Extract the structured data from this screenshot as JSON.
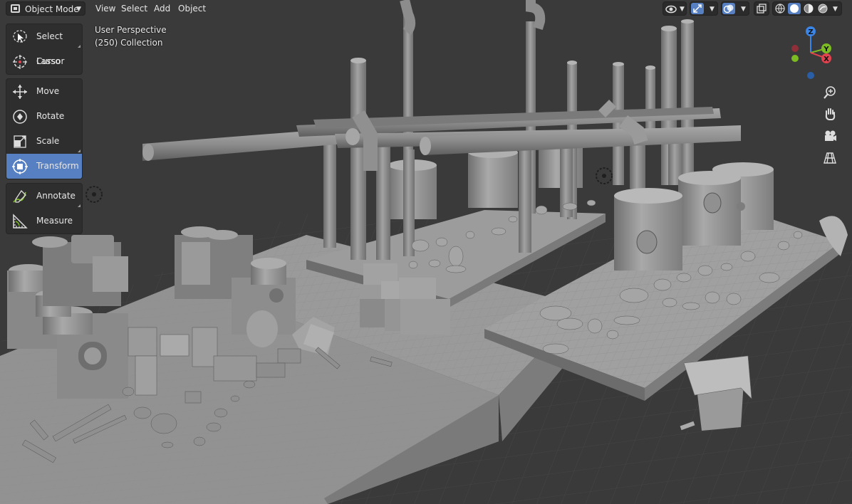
{
  "header": {
    "mode": "Object Mode",
    "menus": [
      "View",
      "Select",
      "Add",
      "Object"
    ],
    "icons": {
      "visibility": "eye-icon",
      "gizmo": "gizmo-icon",
      "overlays": "overlays-icon",
      "xray": "xray-icon",
      "shading": [
        "wireframe-shading-icon",
        "solid-shading-icon",
        "material-shading-icon",
        "rendered-shading-icon"
      ]
    }
  },
  "toolbar": {
    "groups": [
      [
        {
          "label": "Select Lasso",
          "icon": "select-lasso-icon"
        },
        {
          "label": "Cursor",
          "icon": "cursor-icon"
        }
      ],
      [
        {
          "label": "Move",
          "icon": "move-icon"
        },
        {
          "label": "Rotate",
          "icon": "rotate-icon"
        },
        {
          "label": "Scale",
          "icon": "scale-icon"
        },
        {
          "label": "Transform",
          "icon": "transform-icon",
          "active": true
        }
      ],
      [
        {
          "label": "Annotate",
          "icon": "annotate-icon"
        },
        {
          "label": "Measure",
          "icon": "measure-icon"
        }
      ]
    ]
  },
  "viewport_info": {
    "perspective": "User Perspective",
    "collection": "(250) Collection"
  },
  "gizmo": {
    "x": "X",
    "y": "Y",
    "z": "Z"
  },
  "colors": {
    "active": "#5680c2",
    "x_axis": "#e0424e",
    "y_axis": "#7dbb22",
    "z_axis": "#3b85e6"
  },
  "nav_buttons": [
    "zoom-icon",
    "pan-hand-icon",
    "camera-icon",
    "perspective-grid-icon"
  ]
}
